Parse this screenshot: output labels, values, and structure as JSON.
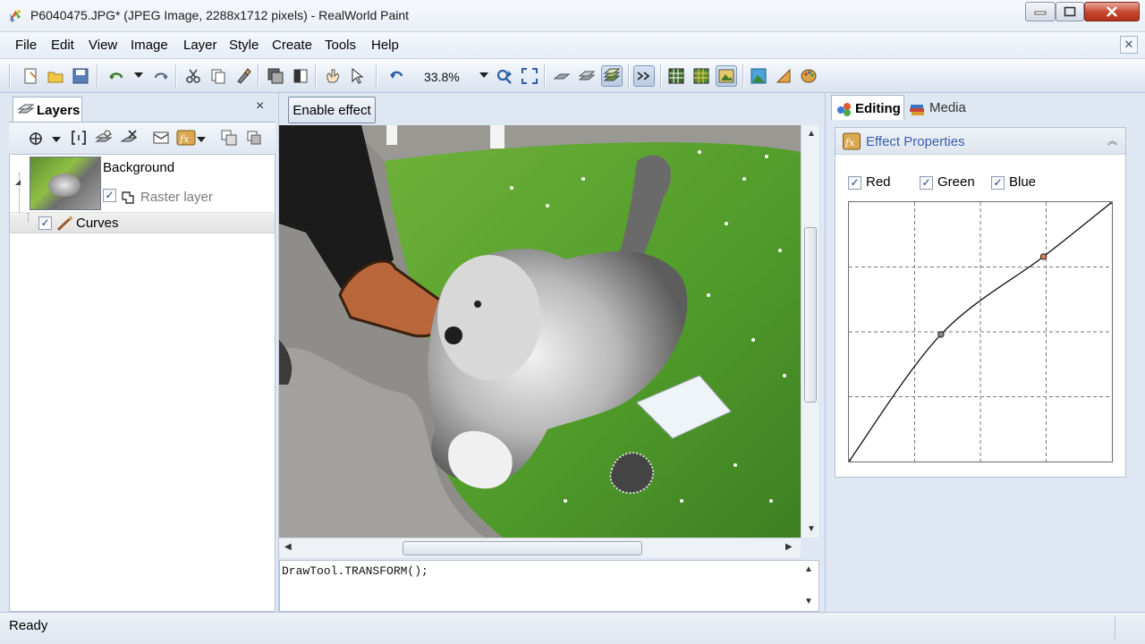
{
  "window": {
    "title": "P6040475.JPG* (JPEG Image, 2288x1712 pixels) - RealWorld Paint"
  },
  "menu": {
    "items": [
      "File",
      "Edit",
      "View",
      "Image",
      "Layer",
      "Style",
      "Create",
      "Tools",
      "Help"
    ]
  },
  "toolbar": {
    "zoom": "33.8%",
    "icons": [
      "new-document-icon",
      "open-folder-icon",
      "save-icon",
      "undo-icon",
      "redo-icon",
      "cut-icon",
      "copy-icon",
      "paste-brush-icon",
      "layer-stack-icon",
      "grayscale-icon",
      "hand-tool-icon",
      "pointer-tool-icon",
      "zoom-out-icon",
      "zoom-in-icon",
      "fit-screen-icon",
      "layer-flat-icon",
      "layer-multi-icon",
      "layer-stack-active-icon",
      "transform-icon",
      "grid-icon",
      "grid-color-icon",
      "image-frame-icon",
      "image-picture-icon",
      "ruler-icon",
      "palette-icon"
    ]
  },
  "layers_panel": {
    "tab_label": "Layers",
    "close_symbol": "×",
    "layers": [
      {
        "name": "Background",
        "sublabel": "Raster layer",
        "checked": true
      },
      {
        "name": "Curves",
        "checked": true
      }
    ]
  },
  "canvas": {
    "enable_effect_label": "Enable effect",
    "console_text": "DrawTool.TRANSFORM();"
  },
  "right_panel": {
    "tabs": [
      {
        "label": "Editing",
        "active": true
      },
      {
        "label": "Media",
        "active": false
      }
    ],
    "effect_properties": {
      "title": "Effect Properties",
      "channels": [
        {
          "label": "Red",
          "checked": true
        },
        {
          "label": "Green",
          "checked": true
        },
        {
          "label": "Blue",
          "checked": true
        }
      ],
      "curve_points": [
        [
          0,
          0
        ],
        [
          0.35,
          0.49
        ],
        [
          0.74,
          0.79
        ],
        [
          1,
          1
        ]
      ]
    }
  },
  "status": {
    "text": "Ready"
  },
  "colors": {
    "accent_blue": "#3a5ea8",
    "window_bg": "#dfe7f2",
    "close_red": "#c7442c"
  }
}
